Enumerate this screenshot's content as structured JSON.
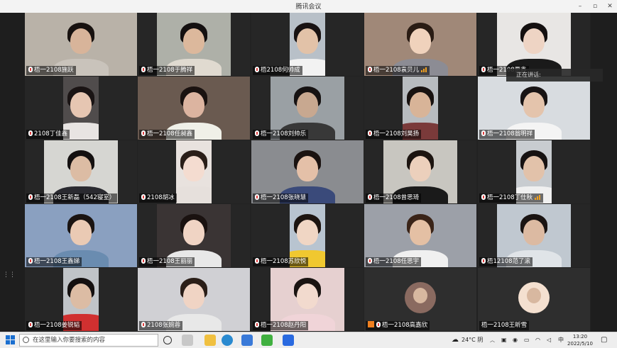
{
  "window": {
    "title": "腾讯会议",
    "min": "–",
    "max": "▫",
    "close": "✕"
  },
  "participants": [
    {
      "name": "梧一2108施跃",
      "skin": "#d8b49a",
      "hair": "#181210",
      "shirt": "#c9c3bb",
      "bg": "#b9b2a8"
    },
    {
      "name": "梧一2108于腾祥",
      "skin": "#dcb89c",
      "hair": "#141010",
      "shirt": "#e0dad0",
      "bg": "#aeb0a8"
    },
    {
      "name": "梧2108何帅成",
      "skin": "#e2c2a8",
      "hair": "#181212",
      "shirt": "#f2f2f2",
      "bg": "#b8c0c8"
    },
    {
      "name": "梧一2108袁贝儿",
      "skin": "#f0d2bc",
      "hair": "#2a1c14",
      "shirt": "#8c8c94",
      "bg": "#a08878",
      "signal": true
    },
    {
      "name": "梧一2108贾鑫",
      "skin": "#eed4c4",
      "hair": "#141010",
      "shirt": "#1a1a1a",
      "bg": "#e8e6e4"
    },
    {
      "name": "2108丁佳鑫",
      "skin": "#e6c6b2",
      "hair": "#1a1414",
      "shirt": "#e8e4e2",
      "bg": "#504c4c"
    },
    {
      "name": "梧一2108任昶鑫",
      "skin": "#dcb4a0",
      "hair": "#1a1210",
      "shirt": "#f0f0e8",
      "bg": "#6a5a50"
    },
    {
      "name": "梧一2108刘帅乐",
      "skin": "#c8a890",
      "hair": "#161212",
      "shirt": "#383838",
      "bg": "#9aa0a4"
    },
    {
      "name": "梧一2108刘昊扬",
      "skin": "#d8b498",
      "hair": "#181210",
      "shirt": "#7a3a3a",
      "bg": "#b8bcc0"
    },
    {
      "name": "梧一2108翁明祥",
      "skin": "#e4c4ac",
      "hair": "#181414",
      "shirt": "#f4f4f4",
      "bg": "#d8dce0"
    },
    {
      "name": "梧一2108王新磊（542寝室）",
      "skin": "#dcbca4",
      "hair": "#141010",
      "shirt": "#2a2a30",
      "bg": "#d6d6d2"
    },
    {
      "name": "2108胡冰",
      "skin": "#f4dcd0",
      "hair": "#2a1e18",
      "shirt": "#e6e0dc",
      "bg": "#e8e2de"
    },
    {
      "name": "梧一2108张晓慧",
      "skin": "#e4c0a8",
      "hair": "#1a1210",
      "shirt": "#3a4a7a",
      "bg": "#8a8c90"
    },
    {
      "name": "梧一2108曾思琦",
      "skin": "#ecd0bc",
      "hair": "#1c1410",
      "shirt": "#1a1a1a",
      "bg": "#c8c6c0"
    },
    {
      "name": "梧一2108丁仕秋",
      "skin": "#e2c2aa",
      "hair": "#161212",
      "shirt": "#f0f0f0",
      "bg": "#c8ccd0",
      "signal": true
    },
    {
      "name": "梧一2108王鑫娣",
      "skin": "#eacab4",
      "hair": "#1a1412",
      "shirt": "#6a8cb0",
      "bg": "#8aa0c0"
    },
    {
      "name": "梧一2108王丽丽",
      "skin": "#f0d4c4",
      "hair": "#1a1210",
      "shirt": "#e8e8e8",
      "bg": "#3a3434"
    },
    {
      "name": "梧一2108苏欣悦",
      "skin": "#f0d6c4",
      "hair": "#1c1410",
      "shirt": "#f0c830",
      "bg": "#b8c4d0"
    },
    {
      "name": "梧一2108任思宇",
      "skin": "#e4c0a4",
      "hair": "#3a2418",
      "shirt": "#f0f0f0",
      "bg": "#9ca0a8"
    },
    {
      "name": "梧12108范了滚",
      "skin": "#dcbaa2",
      "hair": "#1a1412",
      "shirt": "#e0e4e8",
      "bg": "#c0c8d0"
    },
    {
      "name": "梧一2108姜锐韬",
      "skin": "#dcbca4",
      "hair": "#141010",
      "shirt": "#d03030",
      "bg": "#c0c4c8"
    },
    {
      "name": "2108张婉蓉",
      "skin": "#f0d4c4",
      "hair": "#2a1e18",
      "shirt": "#e8e8e8",
      "bg": "#d0d0d4"
    },
    {
      "name": "梧一2108赵丹阳",
      "skin": "#f2dace",
      "hair": "#1a1412",
      "shirt": "#f0d4d8",
      "bg": "#e6d0d0"
    },
    {
      "name": "梧一2108高嘉欣",
      "avatar": true,
      "avatarColor": "#8a6a60",
      "badge": true
    },
    {
      "name": "梧一2108王昕雪",
      "avatar": true,
      "avatarColor": "#f4e0d0",
      "noMic": true
    }
  ],
  "speaking": {
    "label": "正在讲话:"
  },
  "taskbar": {
    "search_placeholder": "在这里输入你要搜索的内容",
    "weather": "24°C 阴",
    "ime": "中",
    "time": "13:20",
    "date": "2022/5/10"
  },
  "colors": {
    "accent": "#1a6fd0",
    "signal": "#f0a020",
    "badge": "#f08020"
  }
}
